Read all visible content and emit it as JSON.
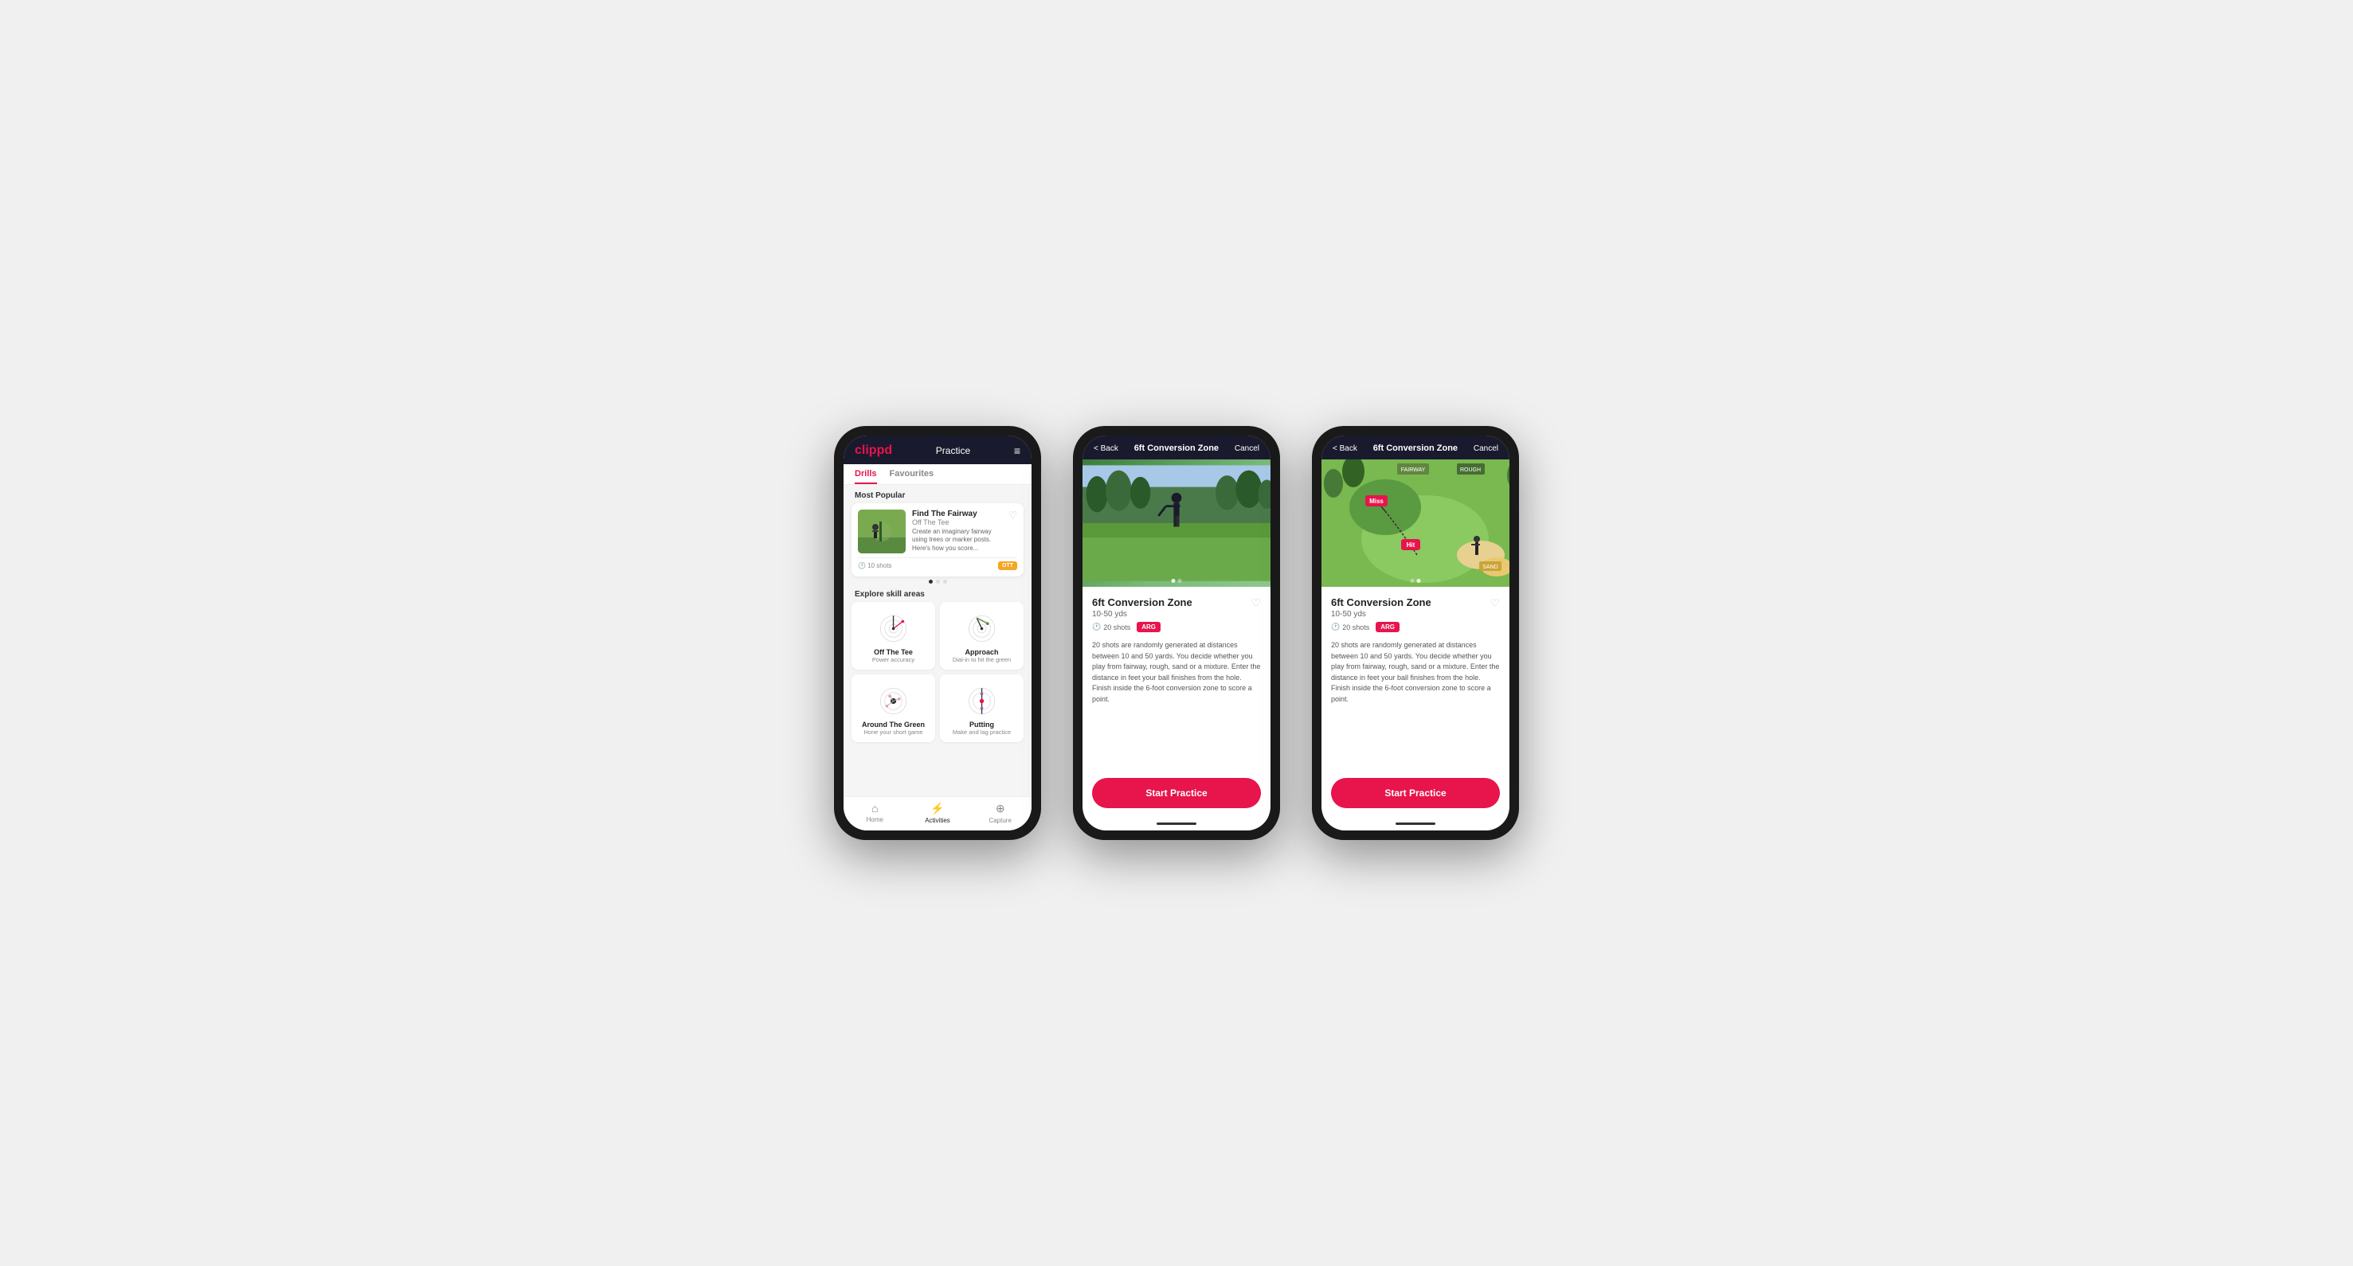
{
  "phone1": {
    "logo": "clippd",
    "nav_title": "Practice",
    "menu_icon": "≡",
    "tabs": [
      "Drills",
      "Favourites"
    ],
    "active_tab": "Drills",
    "most_popular_label": "Most Popular",
    "featured_drill": {
      "title": "Find The Fairway",
      "subtitle": "Off The Tee",
      "description": "Create an imaginary fairway using trees or marker posts. Here's how you score...",
      "shots": "10 shots",
      "badge": "OTT"
    },
    "dots": [
      "active",
      "inactive",
      "inactive"
    ],
    "explore_label": "Explore skill areas",
    "skill_areas": [
      {
        "name": "Off The Tee",
        "desc": "Power accuracy"
      },
      {
        "name": "Approach",
        "desc": "Dial-in to hit the green"
      },
      {
        "name": "Around The Green",
        "desc": "Hone your short game"
      },
      {
        "name": "Putting",
        "desc": "Make and lag practice"
      }
    ],
    "bottom_nav": [
      {
        "label": "Home",
        "icon": "⌂"
      },
      {
        "label": "Activities",
        "icon": "⚡",
        "active": true
      },
      {
        "label": "Capture",
        "icon": "⊕"
      }
    ]
  },
  "phone2": {
    "back_label": "< Back",
    "nav_title": "6ft Conversion Zone",
    "cancel_label": "Cancel",
    "drill_title": "6ft Conversion Zone",
    "range": "10-50 yds",
    "shots": "20 shots",
    "badge": "ARG",
    "description": "20 shots are randomly generated at distances between 10 and 50 yards. You decide whether you play from fairway, rough, sand or a mixture. Enter the distance in feet your ball finishes from the hole. Finish inside the 6-foot conversion zone to score a point.",
    "start_btn": "Start Practice",
    "dots": [
      "active",
      "inactive"
    ],
    "image_type": "photo"
  },
  "phone3": {
    "back_label": "< Back",
    "nav_title": "6ft Conversion Zone",
    "cancel_label": "Cancel",
    "drill_title": "6ft Conversion Zone",
    "range": "10-50 yds",
    "shots": "20 shots",
    "badge": "ARG",
    "description": "20 shots are randomly generated at distances between 10 and 50 yards. You decide whether you play from fairway, rough, sand or a mixture. Enter the distance in feet your ball finishes from the hole. Finish inside the 6-foot conversion zone to score a point.",
    "start_btn": "Start Practice",
    "dots": [
      "inactive",
      "active"
    ],
    "image_type": "map"
  }
}
